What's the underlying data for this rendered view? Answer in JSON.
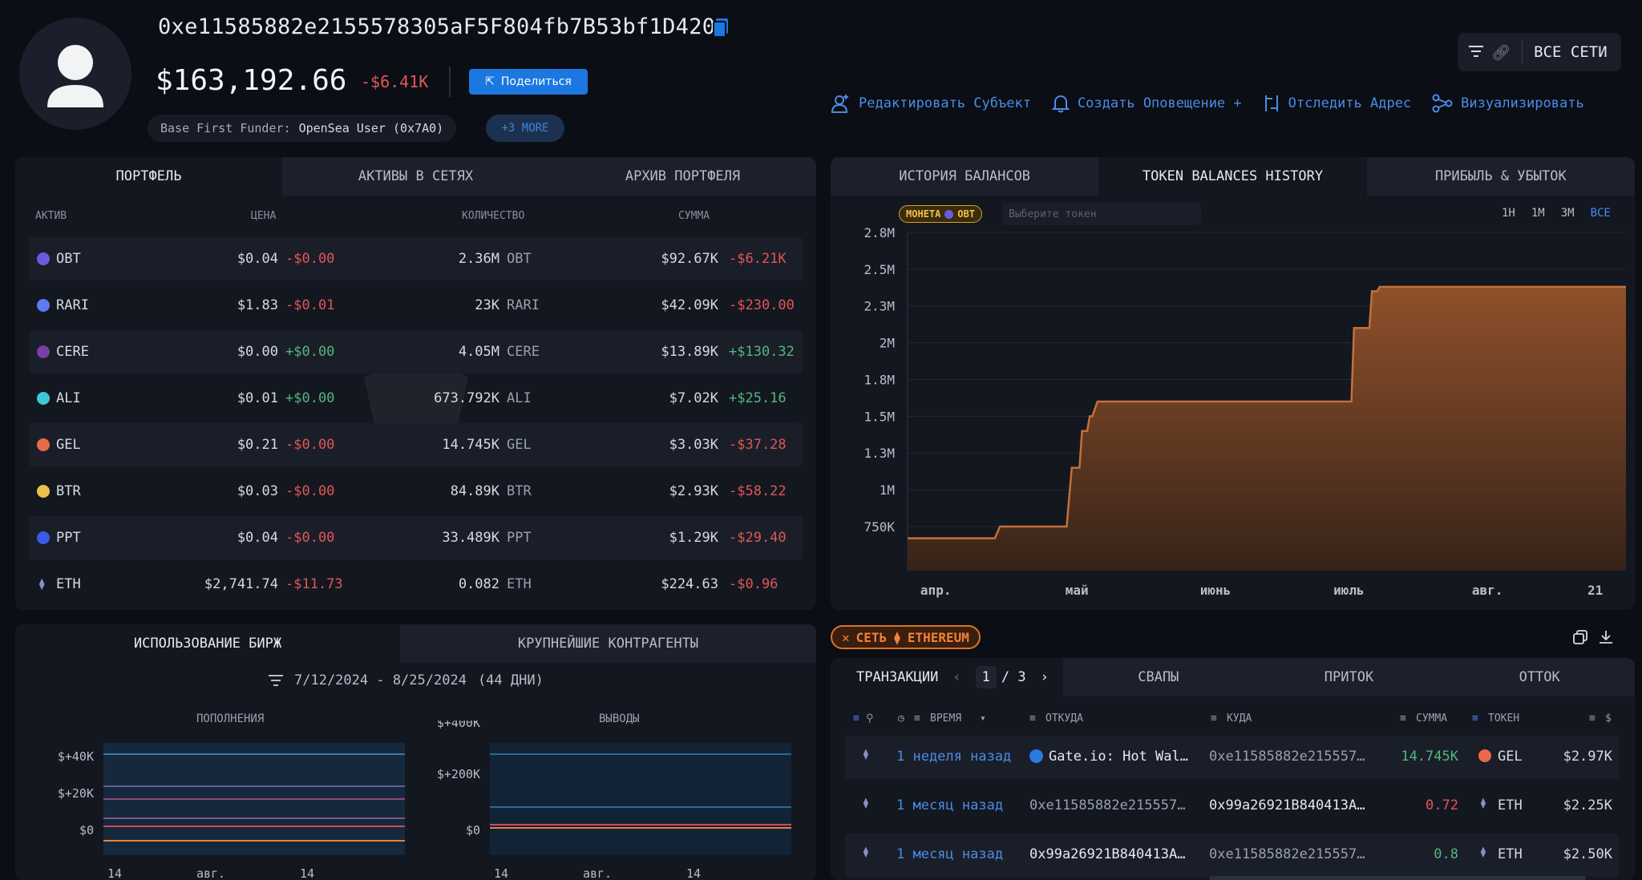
{
  "header": {
    "address": "0xe11585882e2155578305aF5F804fb7B53bf1D420",
    "balance": "$163,192.66",
    "delta": "-$6.41K",
    "share_label": "Поделиться",
    "funder_label": "Base First Funder:",
    "funder_value": "OpenSea User (0x7A0)",
    "more_label": "+3 MORE",
    "networks_label": "ВСЕ СЕТИ"
  },
  "actions": [
    {
      "label": "Редактировать Субъект",
      "icon": "edit-entity-icon"
    },
    {
      "label": "Создать Оповещение +",
      "icon": "bell-icon"
    },
    {
      "label": "Отследить Адрес",
      "icon": "track-icon"
    },
    {
      "label": "Визуализировать",
      "icon": "graph-icon"
    }
  ],
  "portfolio": {
    "tabs": [
      "ПОРТФЕЛЬ",
      "АКТИВЫ В СЕТЯХ",
      "АРХИВ ПОРТФЕЛЯ"
    ],
    "columns": [
      "АКТИВ",
      "ЦЕНА",
      "КОЛИЧЕСТВО",
      "СУММА"
    ],
    "rows": [
      {
        "asset": "OBT",
        "price": "$0.04",
        "pchg": "-$0.00",
        "qty": "2.36M",
        "sym": "OBT",
        "sum": "$92.67K",
        "schg": "-$6.21K",
        "coin": "#6a5ae0"
      },
      {
        "asset": "RARI",
        "price": "$1.83",
        "pchg": "-$0.01",
        "qty": "23K",
        "sym": "RARI",
        "sum": "$42.09K",
        "schg": "-$230.00",
        "coin": "#5c7cf0"
      },
      {
        "asset": "CERE",
        "price": "$0.00",
        "pchg": "+$0.00",
        "qty": "4.05M",
        "sym": "CERE",
        "sum": "$13.89K",
        "schg": "+$130.32",
        "coin": "#7a3ea8"
      },
      {
        "asset": "ALI",
        "price": "$0.01",
        "pchg": "+$0.00",
        "qty": "673.792K",
        "sym": "ALI",
        "sum": "$7.02K",
        "schg": "+$25.16",
        "coin": "#3cc8d8"
      },
      {
        "asset": "GEL",
        "price": "$0.21",
        "pchg": "-$0.00",
        "qty": "14.745K",
        "sym": "GEL",
        "sum": "$3.03K",
        "schg": "-$37.28",
        "coin": "#e86a4a"
      },
      {
        "asset": "BTR",
        "price": "$0.03",
        "pchg": "-$0.00",
        "qty": "84.89K",
        "sym": "BTR",
        "sum": "$2.93K",
        "schg": "-$58.22",
        "coin": "#e8c24a"
      },
      {
        "asset": "PPT",
        "price": "$0.04",
        "pchg": "-$0.00",
        "qty": "33.489K",
        "sym": "PPT",
        "sum": "$1.29K",
        "schg": "-$29.40",
        "coin": "#3a5ce8"
      },
      {
        "asset": "ETH",
        "price": "$2,741.74",
        "pchg": "-$11.73",
        "qty": "0.082",
        "sym": "ETH",
        "sum": "$224.63",
        "schg": "-$0.96",
        "coin": "#8a90c0"
      }
    ]
  },
  "balance_chart": {
    "tabs": [
      "ИСТОРИЯ БАЛАНСОВ",
      "TOKEN BALANCES HISTORY",
      "ПРИБЫЛЬ & УБЫТОК"
    ],
    "coin_chip": "МОНЕТА",
    "coin_chip_token": "OBT",
    "token_placeholder": "Выберите токен",
    "ranges": [
      "1H",
      "1M",
      "3M",
      "ВСЕ"
    ]
  },
  "chart_data": [
    {
      "type": "area",
      "ylim": [
        500000,
        2800000
      ],
      "yticks": [
        "2.8M",
        "2.5M",
        "2.3M",
        "2M",
        "1.8M",
        "1.5M",
        "1.3M",
        "1M",
        "750K"
      ],
      "ytick_values": [
        2800000,
        2550000,
        2300000,
        2050000,
        1800000,
        1550000,
        1300000,
        1050000,
        800000
      ],
      "xticks": [
        "апр.",
        "май",
        "июнь",
        "июль",
        "авг.",
        "21"
      ],
      "xtick_pos": [
        0.055,
        0.33,
        0.6,
        0.86,
        1.13,
        1.34
      ],
      "x": [
        0,
        0.17,
        0.18,
        0.31,
        0.32,
        0.335,
        0.34,
        0.35,
        0.355,
        0.36,
        0.37,
        0.865,
        0.87,
        0.9,
        0.905,
        0.915,
        0.92,
        1.4
      ],
      "y": [
        720000,
        720000,
        800000,
        800000,
        1200000,
        1200000,
        1450000,
        1450000,
        1550000,
        1550000,
        1650000,
        1650000,
        2150000,
        2150000,
        2400000,
        2400000,
        2430000,
        2430000
      ],
      "color": "#c2703a"
    },
    {
      "type": "area",
      "title": "ПОПОЛНЕНИЯ",
      "yticks": [
        "$+40K",
        "$+20K",
        "$0"
      ],
      "xticks": [
        "14",
        "авг.",
        "14"
      ]
    },
    {
      "type": "area",
      "title": "ВЫВОДЫ",
      "yticks": [
        "$+400K",
        "$+200K",
        "$0"
      ],
      "xticks": [
        "14",
        "авг.",
        "14"
      ]
    }
  ],
  "exchange": {
    "tabs": [
      "ИСПОЛЬЗОВАНИЕ БИРЖ",
      "КРУПНЕЙШИЕ КОНТРАГЕНТЫ"
    ],
    "range": "7/12/2024 - 8/25/2024",
    "days": "(44 ДНИ)"
  },
  "transactions": {
    "network_chip": "СЕТЬ",
    "network_name": "ETHEREUM",
    "tab_label": "ТРАНЗАКЦИИ",
    "page": "1",
    "pages": "/ 3",
    "tabs": [
      "СВАПЫ",
      "ПРИТОК",
      "ОТТОК"
    ],
    "columns": {
      "time": "ВРЕМЯ",
      "from": "ОТКУДА",
      "to": "КУДА",
      "amount": "СУММА",
      "token": "ТОКЕН",
      "usd": "$"
    },
    "rows": [
      {
        "time": "1 неделя назад",
        "from": "Gate.io: Hot Wal…",
        "to": "0xe11585882e215557…",
        "amount": "14.745K",
        "token": "GEL",
        "usd": "$2.97K",
        "dir": "in"
      },
      {
        "time": "1 месяц назад",
        "from": "0xe11585882e215557…",
        "to": "0x99a26921B840413A…",
        "amount": "0.72",
        "token": "ETH",
        "usd": "$2.25K",
        "dir": "out"
      },
      {
        "time": "1 месяц назад",
        "from": "0x99a26921B840413A…",
        "to": "0xe11585882e215557…",
        "amount": "0.8",
        "token": "ETH",
        "usd": "$2.50K",
        "dir": "in"
      }
    ]
  }
}
